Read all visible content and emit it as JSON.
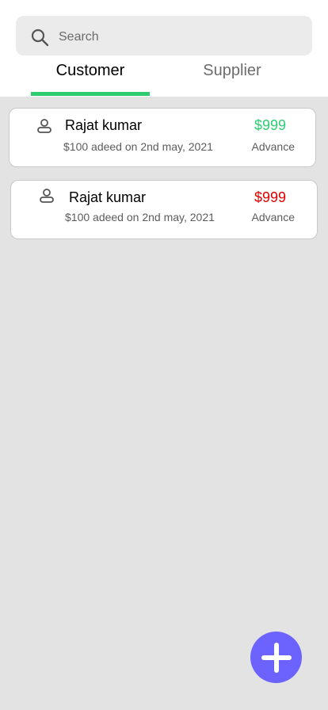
{
  "search": {
    "placeholder": "Search"
  },
  "tabs": [
    {
      "label": "Customer",
      "active": true
    },
    {
      "label": "Supplier",
      "active": false
    }
  ],
  "colors": {
    "active_tab_indicator": "#2ecc71",
    "amount_positive": "#2ecc71",
    "amount_negative": "#e00000",
    "fab": "#6c63ff"
  },
  "entries": [
    {
      "name": "Rajat kumar",
      "detail": "$100 adeed on 2nd may, 2021",
      "amount": "$999",
      "status": "Advance",
      "amount_color": "green",
      "icon": "person-icon"
    },
    {
      "name": "Rajat kumar",
      "detail": "$100 adeed on 2nd may, 2021",
      "amount": "$999",
      "status": "Advance",
      "amount_color": "red",
      "icon": "person-icon"
    }
  ],
  "fab": {
    "icon": "plus-icon"
  }
}
